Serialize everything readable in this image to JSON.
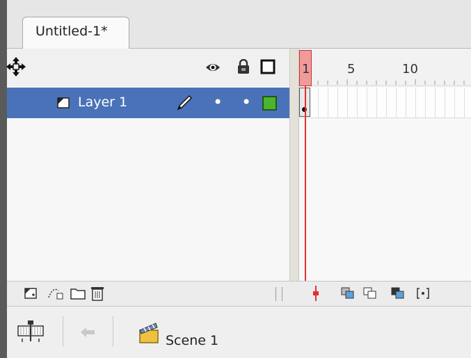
{
  "document_tab": {
    "title": "Untitled-1*"
  },
  "layers": [
    {
      "name": "Layer 1",
      "selected": true,
      "visible_dot": "•",
      "lock_dot": "•",
      "outline_color": "#4cb32e"
    }
  ],
  "ruler": {
    "frame_numbers": [
      "1",
      "5",
      "10"
    ],
    "current_frame": 1
  },
  "scene": {
    "name": "Scene 1"
  },
  "colors": {
    "selection": "#4a72b8",
    "playhead": "#e03030",
    "outline": "#4cb32e"
  },
  "icons": {
    "header": [
      "move-panel-icon",
      "eye-icon",
      "lock-icon",
      "outline-square-icon"
    ],
    "layer_tools": [
      "new-layer-icon",
      "motion-guide-icon",
      "new-folder-icon",
      "trash-icon"
    ],
    "timeline_tools": [
      "center-frame-icon",
      "onion-skin-icon",
      "onion-skin-outlines-icon",
      "edit-multiple-frames-icon",
      "modify-onion-markers-icon"
    ],
    "scene_bar": [
      "timeline-icon",
      "back-arrow-icon",
      "scene-clapper-icon"
    ]
  }
}
